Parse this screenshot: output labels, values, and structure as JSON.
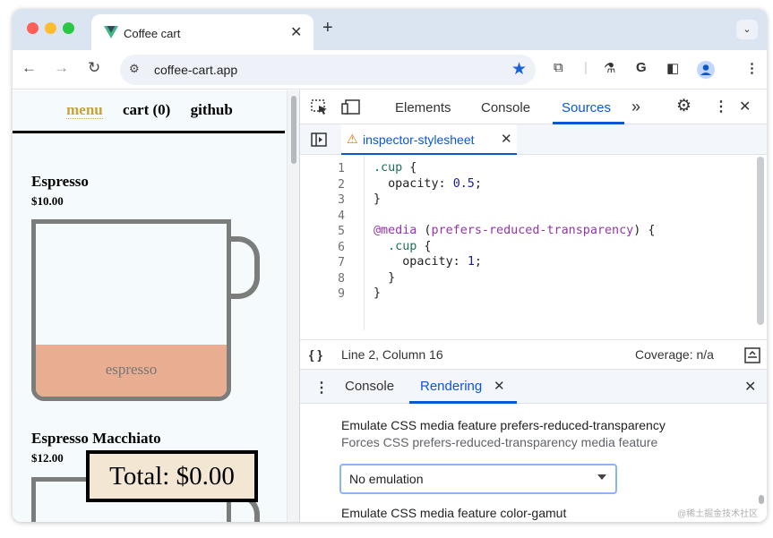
{
  "browser": {
    "tab_title": "Coffee cart",
    "tab_close": "✕",
    "new_tab": "+",
    "tab_menu": "⌄",
    "url": "coffee-cart.app",
    "extension_g": "G"
  },
  "colors": {
    "accent_blue": "#0b57d0",
    "menu_active": "#c7a238",
    "coffee_fill": "#e9ad92",
    "total_bg": "#f3e7d4"
  },
  "page": {
    "nav": {
      "menu": "menu",
      "cart": "cart (0)",
      "github": "github"
    },
    "coffees": [
      {
        "name": "Espresso",
        "price": "$10.00",
        "cup_label": "espresso"
      },
      {
        "name": "Espresso Macchiato",
        "price": "$12.00"
      }
    ],
    "total": "Total: $0.00"
  },
  "devtools": {
    "tabs": {
      "elements": "Elements",
      "console": "Console",
      "sources": "Sources",
      "more": "»"
    },
    "file_tab": {
      "name": "inspector-stylesheet",
      "close": "✕"
    },
    "code_lines": [
      {
        "n": "1"
      },
      {
        "n": "2"
      },
      {
        "n": "3"
      },
      {
        "n": "4"
      },
      {
        "n": "5"
      },
      {
        "n": "6"
      },
      {
        "n": "7"
      },
      {
        "n": "8"
      },
      {
        "n": "9"
      }
    ],
    "code": {
      "l1_sel": ".cup",
      "l1_rest": " {",
      "l2_prop": "  opacity: ",
      "l2_val": "0.5",
      "l2_end": ";",
      "l3": "}",
      "l5_at": "@media",
      "l5_open": " (",
      "l5_feature": "prefers-reduced-transparency",
      "l5_close": ") {",
      "l6_sel": "  .cup",
      "l6_rest": " {",
      "l7_prop": "    opacity: ",
      "l7_val": "1",
      "l7_end": ";",
      "l8": "  }",
      "l9": "}"
    },
    "status": {
      "braces": "{ }",
      "position": "Line 2, Column 16",
      "coverage": "Coverage: n/a"
    },
    "drawer": {
      "tab_console": "Console",
      "tab_rendering": "Rendering",
      "close": "✕",
      "feature_title": "Emulate CSS media feature prefers-reduced-transparency",
      "feature_desc": "Forces CSS prefers-reduced-transparency media feature",
      "select_value": "No emulation",
      "next_feature_title": "Emulate CSS media feature color-gamut"
    }
  },
  "watermark": "@稀土掘金技术社区"
}
